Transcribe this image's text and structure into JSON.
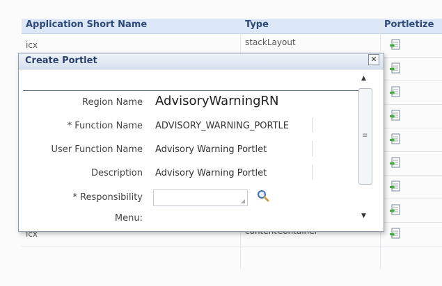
{
  "table": {
    "headers": [
      "Application Short Name",
      "Type",
      "Portletize"
    ],
    "rows": [
      {
        "app": "icx",
        "type": "stackLayout"
      },
      {
        "app": "",
        "type": ""
      },
      {
        "app": "",
        "type": ""
      },
      {
        "app": "",
        "type": ""
      },
      {
        "app": "",
        "type": ""
      },
      {
        "app": "",
        "type": ""
      },
      {
        "app": "",
        "type": ""
      },
      {
        "app": "",
        "type": ""
      },
      {
        "app": "icx",
        "type": "contentContainer"
      }
    ]
  },
  "dialog": {
    "title": "Create Portlet",
    "close_label": "✕",
    "fields": {
      "region_name": {
        "label": "Region Name",
        "value": "AdvisoryWarningRN"
      },
      "function_name": {
        "label": "* Function Name",
        "value": "ADVISORY_WARNING_PORTLE"
      },
      "user_function_name": {
        "label": "User Function Name",
        "value": "Advisory Warning Portlet"
      },
      "description": {
        "label": "Description",
        "value": "Advisory Warning Portlet"
      },
      "responsibility": {
        "label": "* Responsibility",
        "value": ""
      },
      "menu": {
        "label": "Menu:"
      }
    }
  },
  "icons": {
    "portletize": "portletize-icon",
    "search": "search-icon",
    "close": "close-icon"
  }
}
